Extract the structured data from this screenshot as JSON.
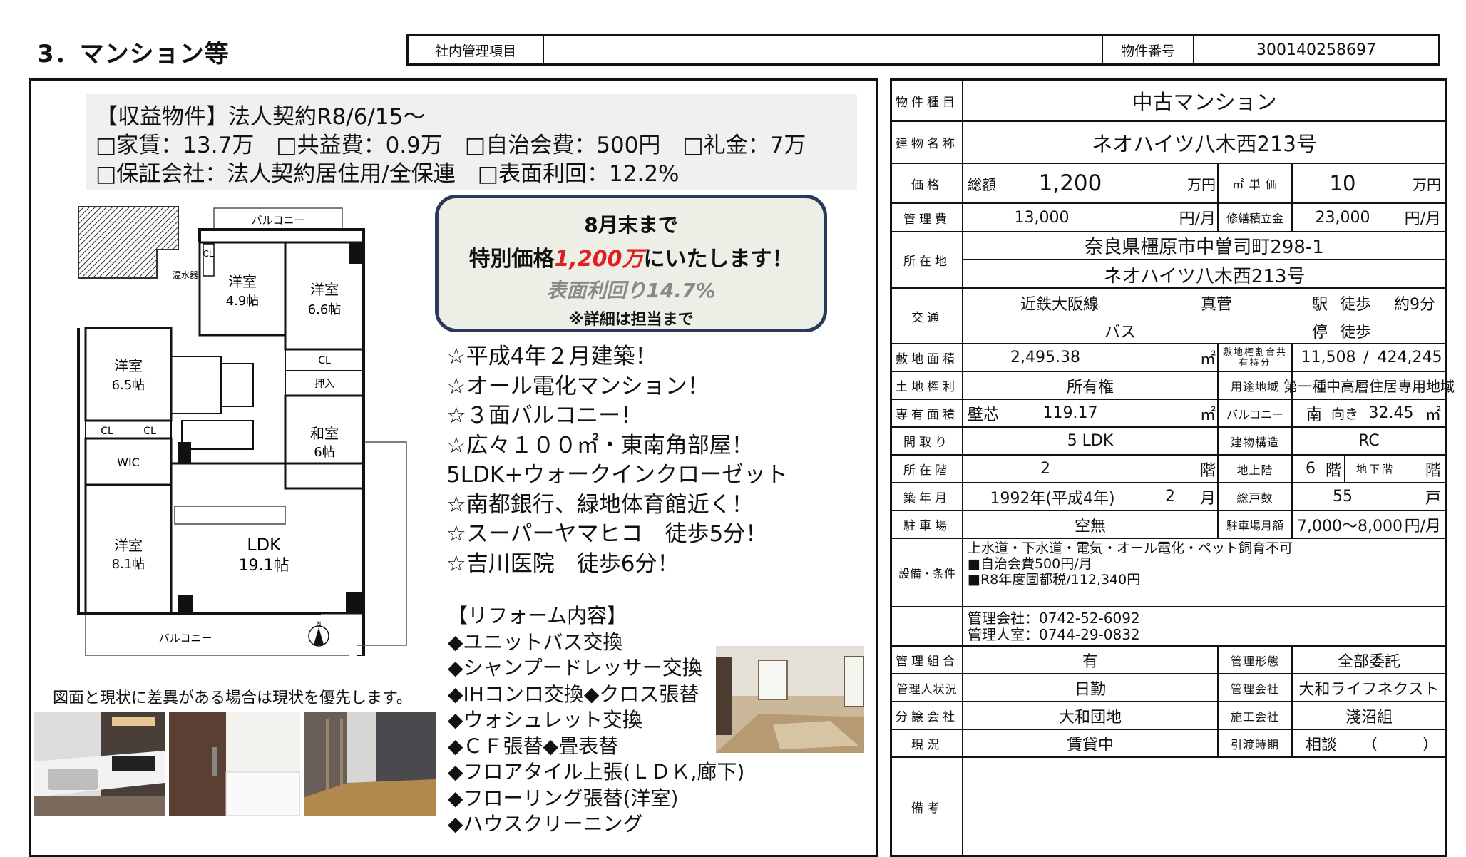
{
  "header": {
    "title": "3．マンション等",
    "internal_label": "社内管理項目",
    "internal_value": "",
    "property_no_label": "物件番号",
    "property_no": "300140258697"
  },
  "summary": {
    "line1": "【収益物件】法人契約R8/6/15～",
    "line2": "□家賃：13.7万　□共益費：0.9万　□自治会費：500円　□礼金：7万",
    "line3": "□保証会社：法人契約居住用/全保連　□表面利回：12.2%"
  },
  "promo": {
    "line1": "8月末まで",
    "line2_pre": "特別価格",
    "line2_price": "1,200万",
    "line2_post": "にいたします！",
    "line3": "表面利回り14.7%",
    "line4": "※詳細は担当まで"
  },
  "features": [
    "☆平成4年２月建築！",
    "☆オール電化マンション！",
    "☆３面バルコニー！",
    "☆広々１００㎡・東南角部屋！",
    "5LDK+ウォークインクローゼット",
    "☆南都銀行、緑地体育館近く！",
    "☆スーパーヤマヒコ　徒歩5分！",
    "☆吉川医院　徒歩6分！"
  ],
  "reform": {
    "title": "【リフォーム内容】",
    "items": [
      "◆ユニットバス交換",
      "◆シャンプードレッサー交換",
      "◆IHコンロ交換◆クロス張替",
      "◆ウォシュレット交換",
      "◆ＣＦ張替◆畳表替",
      "◆フロアタイル上張(ＬＤＫ,廊下)",
      "◆フローリング張替(洋室)",
      "◆ハウスクリーニング"
    ]
  },
  "floorplan": {
    "balcony_top": "バルコニー",
    "balcony_bottom": "バルコニー",
    "rooms": {
      "r1": "洋室",
      "r1s": "4.9帖",
      "r2": "洋室",
      "r2s": "6.6帖",
      "r3": "洋室",
      "r3s": "6.5帖",
      "r4": "和室",
      "r4s": "6帖",
      "r5": "洋室",
      "r5s": "8.1帖",
      "ldk": "LDK",
      "ldks": "19.1帖"
    },
    "heater": "温水器",
    "cl": "CL",
    "oshiire": "押入",
    "wic": "WIC",
    "north": "N"
  },
  "disclaimer": "図面と現状に差異がある場合は現状を優先します。",
  "table": {
    "type_label": "物件種目",
    "type": "中古マンション",
    "name_label": "建物名称",
    "name": "ネオハイツ八木西213号",
    "price_label": "価格",
    "total_label": "総額",
    "price": "1,200",
    "price_unit": "万円",
    "tsubo_label": "㎡ 単 価",
    "unit_price": "10",
    "unit_price_unit": "万円",
    "mgmt_fee_label": "管理費",
    "mgmt_fee": "13,000",
    "per_month": "円/月",
    "repair_label": "修繕積立金",
    "repair": "23,000",
    "address_label": "所在地",
    "address1": "奈良県橿原市中曽司町298-1",
    "address2": "ネオハイツ八木西213号",
    "transport_label": "交通",
    "line": "近鉄大阪線",
    "station": "真菅",
    "station_suffix": "駅",
    "walk": "徒歩",
    "walk_time": "約9分",
    "bus": "バス",
    "stop": "停",
    "walk2": "徒歩",
    "land_area_label": "敷地面積",
    "land_area": "2,495.38",
    "sqm": "㎡",
    "share_label": "敷地権割合共有持分",
    "share1": "11,508",
    "share_sep": "/",
    "share2": "424,245",
    "land_right_label": "土地権利",
    "land_right": "所有権",
    "zoning_label": "用途地域",
    "zoning": "第一種中高層住居専用地域",
    "floor_area_label": "専有面積",
    "wall_label": "壁芯",
    "floor_area": "119.17",
    "balcony_label": "バルコニー",
    "balcony_dir": "南",
    "facing": "向き",
    "balcony_area": "32.45",
    "layout_label": "間取り",
    "layout": "5 LDK",
    "structure_label": "建物構造",
    "structure": "RC",
    "floor_label": "所在階",
    "floor": "2",
    "floor_unit": "階",
    "above_label": "地上階",
    "above": "6",
    "below_label": "地下階",
    "built_label": "築年月",
    "built": "1992年(平成4年)",
    "built_month": "2",
    "month": "月",
    "units_label": "総戸数",
    "units": "55",
    "units_unit": "戸",
    "parking_label": "駐車場",
    "parking": "空無",
    "parking_fee_label": "駐車場月額",
    "parking_fee": "7,000～8,000",
    "equipment_label": "設備・条件",
    "equip1": "上水道・下水道・電気・オール電化・ペット飼育不可",
    "equip2": "■自治会費500円/月",
    "equip3": "■R8年度固都税/112,340円",
    "contact1": "管理会社：0742-52-6092",
    "contact2": "管理人室：0744-29-0832",
    "union_label": "管理組合",
    "union": "有",
    "mgmt_form_label": "管理形態",
    "mgmt_form": "全部委託",
    "manager_label": "管理人状況",
    "manager": "日勤",
    "mgmt_co_label": "管理会社",
    "mgmt_co": "大和ライフネクスト",
    "seller_label": "分譲会社",
    "seller": "大和団地",
    "builder_label": "施工会社",
    "builder": "淺沼組",
    "status_label": "現況",
    "status": "賃貸中",
    "handover_label": "引渡時期",
    "handover": "相談",
    "paren_open": "（",
    "paren_close": "）",
    "remarks_label": "備考"
  },
  "colors": {
    "promo_border": "#2a3a57",
    "promo_bg": "#edeee5",
    "price_red": "#e02020",
    "yield_gray": "#888888"
  }
}
